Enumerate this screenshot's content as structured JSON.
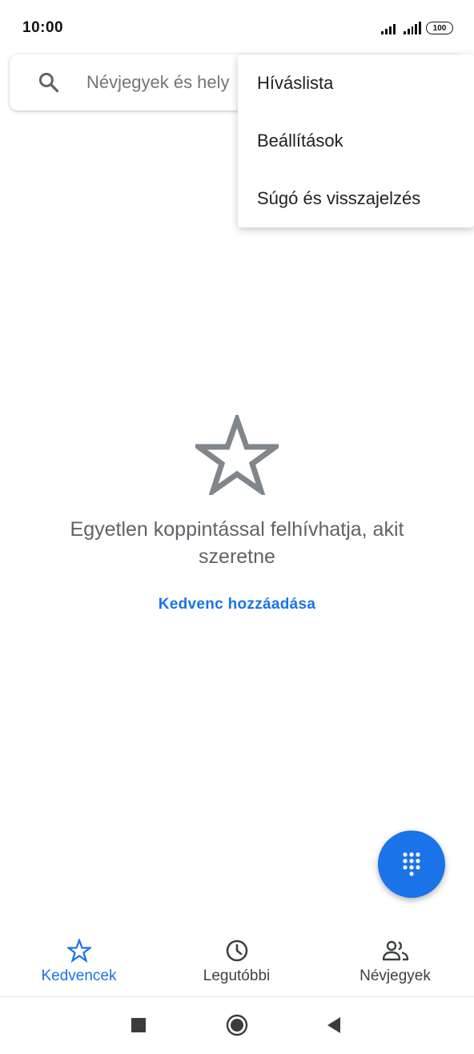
{
  "status_bar": {
    "time": "10:00",
    "battery": "100"
  },
  "search": {
    "placeholder": "Névjegyek és hely"
  },
  "menu": {
    "items": [
      "Híváslista",
      "Beállítások",
      "Súgó és visszajelzés"
    ]
  },
  "empty_state": {
    "message": "Egyetlen koppintással felhívhatja, akit szeretne",
    "action": "Kedvenc hozzáadása"
  },
  "bottom_nav": {
    "tabs": [
      {
        "label": "Kedvencek",
        "icon": "star-icon",
        "active": true
      },
      {
        "label": "Legutóbbi",
        "icon": "clock-icon",
        "active": false
      },
      {
        "label": "Névjegyek",
        "icon": "people-icon",
        "active": false
      }
    ]
  },
  "colors": {
    "accent": "#1a73e8",
    "text_secondary": "#5f6368",
    "icon_gray": "#80868b"
  }
}
